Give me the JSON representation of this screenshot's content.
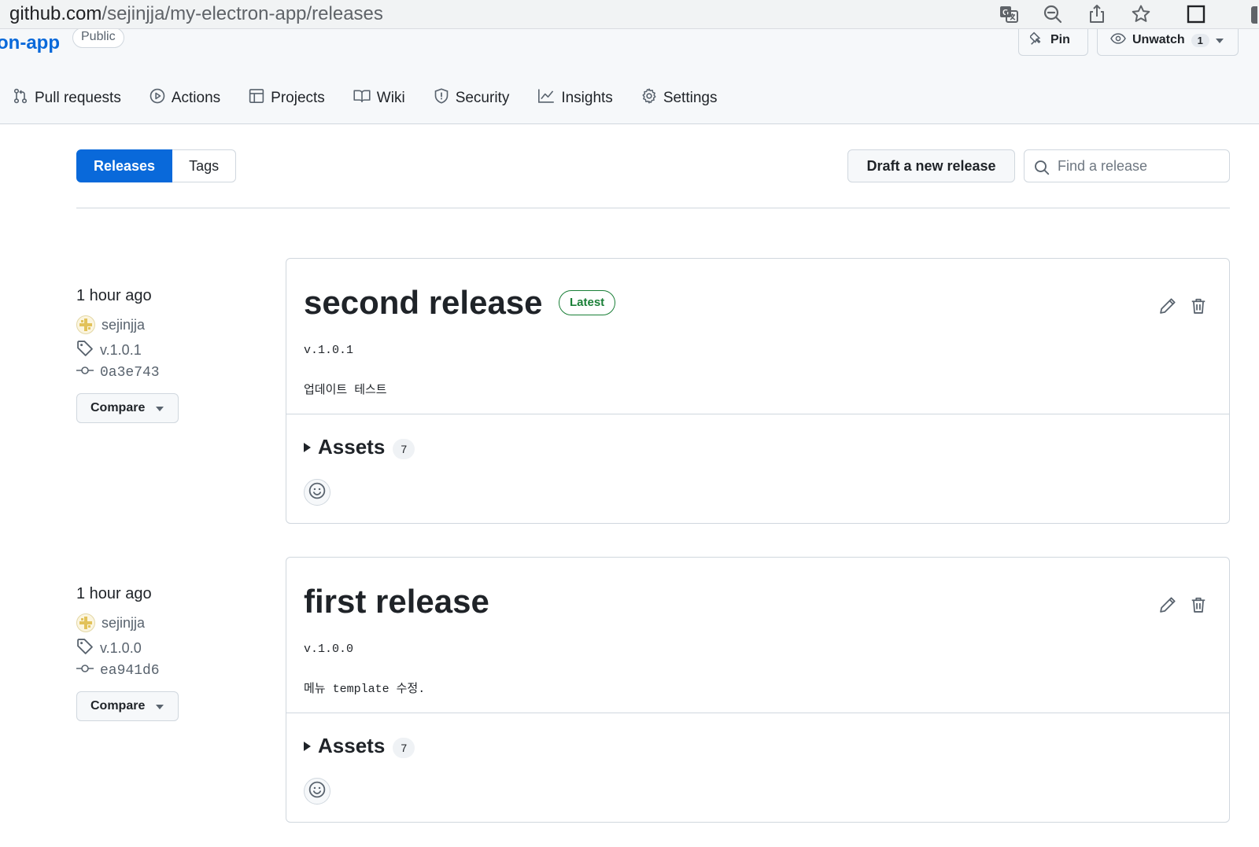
{
  "browser": {
    "url_host": "github.com",
    "url_path": "/sejinjja/my-electron-app/releases"
  },
  "repo": {
    "name_visible": "on-app",
    "visibility": "Public",
    "pin_label": "Pin",
    "watch_label": "Unwatch",
    "watch_count": "1"
  },
  "tabs": [
    {
      "label": "Pull requests",
      "icon": "pull-request-icon"
    },
    {
      "label": "Actions",
      "icon": "play-circle-icon"
    },
    {
      "label": "Projects",
      "icon": "table-icon"
    },
    {
      "label": "Wiki",
      "icon": "book-icon"
    },
    {
      "label": "Security",
      "icon": "shield-icon"
    },
    {
      "label": "Insights",
      "icon": "graph-icon"
    },
    {
      "label": "Settings",
      "icon": "gear-icon"
    }
  ],
  "subnav": {
    "releases_label": "Releases",
    "tags_label": "Tags",
    "draft_label": "Draft a new release",
    "search_placeholder": "Find a release"
  },
  "releases": [
    {
      "time": "1 hour ago",
      "author": "sejinjja",
      "tag": "v.1.0.1",
      "commit": "0a3e743",
      "compare_label": "Compare",
      "title": "second release",
      "latest_label": "Latest",
      "tag_text": "v.1.0.1",
      "notes": "업데이트 테스트",
      "assets_label": "Assets",
      "assets_count": "7"
    },
    {
      "time": "1 hour ago",
      "author": "sejinjja",
      "tag": "v.1.0.0",
      "commit": "ea941d6",
      "compare_label": "Compare",
      "title": "first release",
      "tag_text": "v.1.0.0",
      "notes": "메뉴 template 수정.",
      "assets_label": "Assets",
      "assets_count": "7"
    }
  ],
  "colors": {
    "accent": "#0969da",
    "latest_green": "#1a7f37",
    "border": "#d0d7de"
  }
}
